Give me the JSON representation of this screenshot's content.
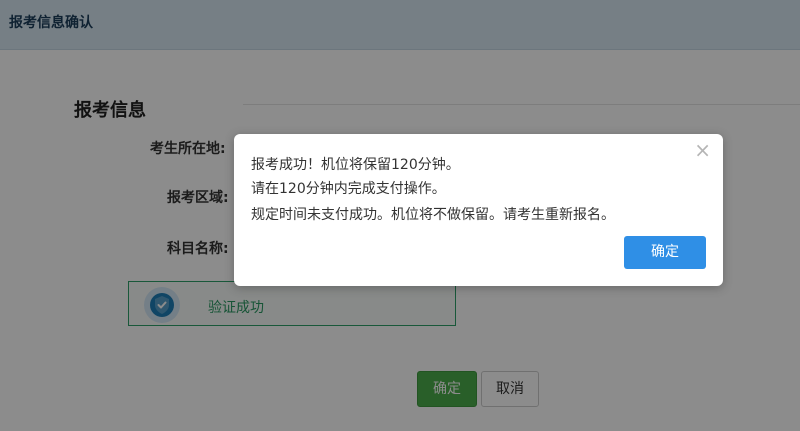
{
  "header": {
    "title": "报考信息确认"
  },
  "section": {
    "title": "报考信息"
  },
  "fields": {
    "location_label": "考生所在地:",
    "area_label": "报考区域:",
    "subject_label": "科目名称:"
  },
  "verify": {
    "text": "验证成功",
    "icon": "shield-check-icon"
  },
  "actions": {
    "confirm_label": "确定",
    "cancel_label": "取消"
  },
  "dialog": {
    "close_glyph": "×",
    "messages": [
      "报考成功！机位将保留120分钟。",
      "请在120分钟内完成支付操作。",
      "规定时间未支付成功。机位将不做保留。请考生重新报名。"
    ],
    "ok_label": "确定"
  },
  "colors": {
    "header_bg": "#d8e8f3",
    "verify_green": "#2fa16a",
    "confirm_green": "#4cae4c",
    "dialog_ok_blue": "#2f8fe6"
  }
}
